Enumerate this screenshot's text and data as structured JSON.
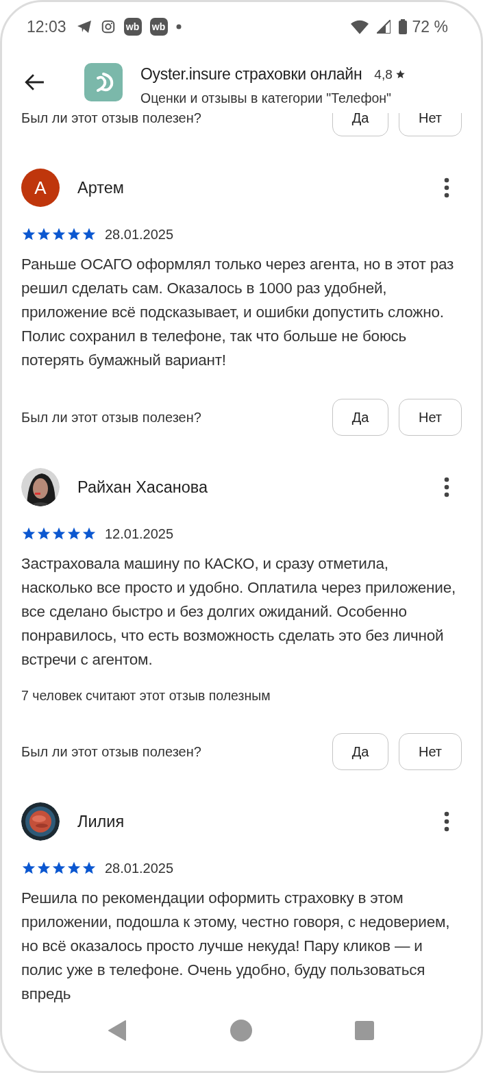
{
  "status_bar": {
    "time": "12:03",
    "app_badges": [
      "wb",
      "wb"
    ],
    "battery": "72 %"
  },
  "header": {
    "title": "Oyster.insure страховки онлайн",
    "rating": "4,8",
    "subtitle": "Оценки и отзывы в категории \"Телефон\""
  },
  "previous_feedback": {
    "question": "Был ли этот отзыв полезен?",
    "yes": "Да",
    "no": "Нет"
  },
  "reviews": [
    {
      "author": "Артем",
      "avatar": {
        "kind": "letter",
        "letter": "А",
        "color": "#bf360c"
      },
      "stars": 5,
      "date": "28.01.2025",
      "text": "Раньше ОСАГО оформлял только через агента, но в этот раз решил сделать сам. Оказалось в 1000 раз удобней, приложение всё подсказывает, и ошибки допустить сложно. Полис сохранил в телефоне, так что больше не боюсь потерять бумажный вариант!",
      "feedback": {
        "question": "Был ли этот отзыв полезен?",
        "yes": "Да",
        "no": "Нет"
      }
    },
    {
      "author": "Райхан Хасанова",
      "stars": 5,
      "date": "12.01.2025",
      "text": "Застраховала машину по КАСКО, и сразу отметила, насколько все просто и удобно. Оплатила через приложение, все сделано быстро и без долгих ожиданий. Особенно понравилось, что есть возможность сделать это без личной встречи с агентом.",
      "helpful": "7 человек считают этот отзыв полезным",
      "feedback": {
        "question": "Был ли этот отзыв полезен?",
        "yes": "Да",
        "no": "Нет"
      }
    },
    {
      "author": "Лилия",
      "stars": 5,
      "date": "28.01.2025",
      "text": "Решила по рекомендации оформить страховку в этом приложении, подошла к этому, честно говоря, с недоверием, но всё оказалось просто лучше некуда! Пару кликов — и полис уже в телефоне. Очень удобно, буду пользоваться впредь"
    }
  ]
}
